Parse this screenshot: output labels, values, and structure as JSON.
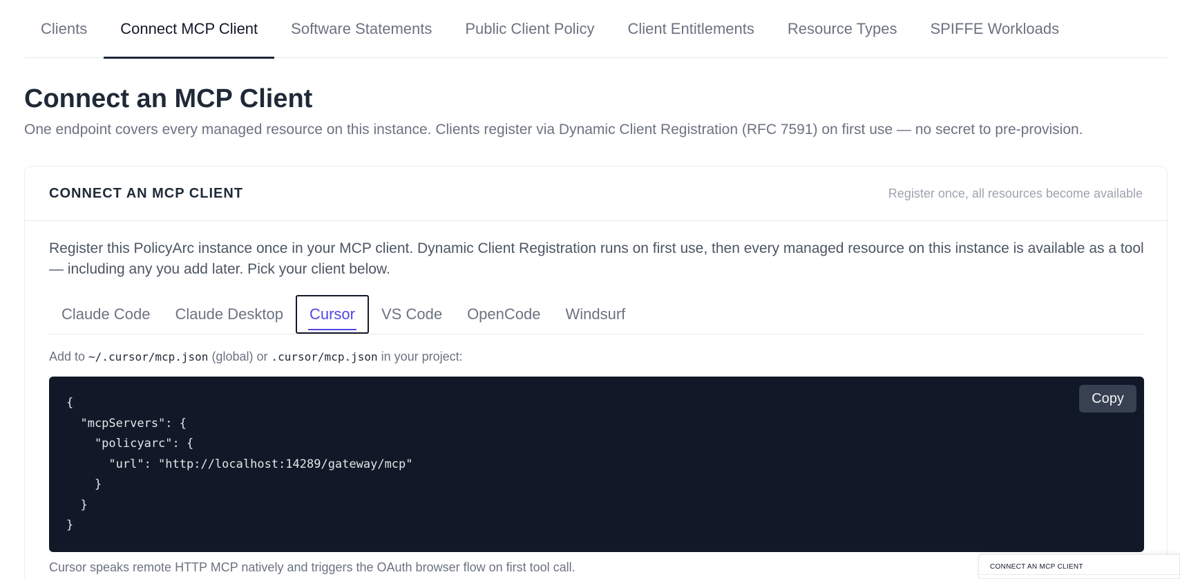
{
  "top_tabs": [
    {
      "label": "Clients"
    },
    {
      "label": "Connect MCP Client"
    },
    {
      "label": "Software Statements"
    },
    {
      "label": "Public Client Policy"
    },
    {
      "label": "Client Entitlements"
    },
    {
      "label": "Resource Types"
    },
    {
      "label": "SPIFFE Workloads"
    }
  ],
  "active_top_tab": "Connect MCP Client",
  "page": {
    "title": "Connect an MCP Client",
    "subtitle": "One endpoint covers every managed resource on this instance. Clients register via Dynamic Client Registration (RFC 7591) on first use — no secret to pre-provision."
  },
  "card": {
    "title": "CONNECT AN MCP CLIENT",
    "hint": "Register once, all resources become available",
    "intro": "Register this PolicyArc instance once in your MCP client. Dynamic Client Registration runs on first use, then every managed resource on this instance is available as a tool — including any you add later. Pick your client below.",
    "client_tabs": [
      {
        "label": "Claude Code"
      },
      {
        "label": "Claude Desktop"
      },
      {
        "label": "Cursor"
      },
      {
        "label": "VS Code"
      },
      {
        "label": "OpenCode"
      },
      {
        "label": "Windsurf"
      }
    ],
    "active_client_tab": "Cursor",
    "instruction": {
      "prefix": "Add to ",
      "path_global": "~/.cursor/mcp.json",
      "middle": " (global) or ",
      "path_project": ".cursor/mcp.json",
      "suffix": " in your project:"
    },
    "code_lines": [
      "{",
      "  \"mcpServers\": {",
      "    \"policyarc\": {",
      "      \"url\": \"http://localhost:14289/gateway/mcp\"",
      "    }",
      "  }",
      "}"
    ],
    "copy_label": "Copy",
    "footer_note": "Cursor speaks remote HTTP MCP natively and triggers the OAuth browser flow on first tool call."
  },
  "floating_label": "CONNECT AN MCP CLIENT",
  "colors": {
    "accent": "#4f46e5",
    "code_bg": "#111827",
    "muted_text": "#6b7280"
  }
}
